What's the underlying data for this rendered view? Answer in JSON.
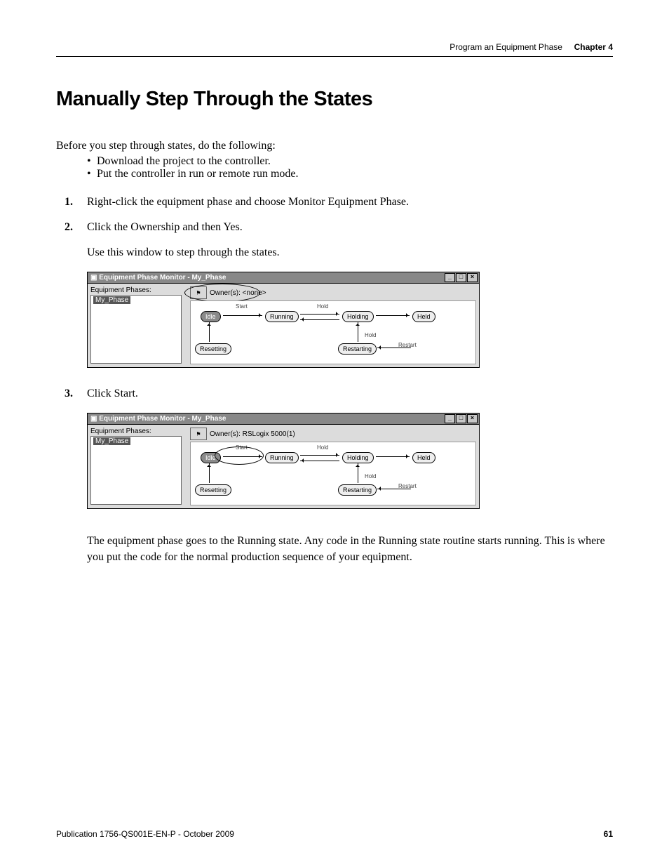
{
  "header": {
    "left": "Program an Equipment Phase",
    "right": "Chapter 4"
  },
  "title": "Manually Step Through the States",
  "intro": "Before you step through states, do the following:",
  "bullets": [
    "Download the project to the controller.",
    "Put the controller in run or remote run mode."
  ],
  "steps": {
    "s1_num": "1.",
    "s1": "Right-click the equipment phase and choose Monitor Equipment Phase.",
    "s2_num": "2.",
    "s2": "Click the Ownership and then Yes.",
    "s2_sub": "Use this window to step through the states.",
    "s3_num": "3.",
    "s3": "Click Start."
  },
  "win1": {
    "title": "Equipment Phase Monitor - My_Phase",
    "tree_label": "Equipment Phases:",
    "tree_item": "My_Phase",
    "owner_label": "Owner(s): <none>",
    "states": {
      "idle": "Idle",
      "running": "Running",
      "holding": "Holding",
      "held": "Held",
      "resetting": "Resetting",
      "restarting": "Restarting"
    },
    "labels": {
      "start": "Start",
      "hold1": "Hold",
      "hold2": "Hold",
      "restart": "Restart"
    }
  },
  "win2": {
    "title": "Equipment Phase Monitor - My_Phase",
    "tree_label": "Equipment Phases:",
    "tree_item": "My_Phase",
    "owner_label": "Owner(s): RSLogix 5000(1)",
    "states": {
      "idle": "Idle",
      "running": "Running",
      "holding": "Holding",
      "held": "Held",
      "resetting": "Resetting",
      "restarting": "Restarting"
    },
    "labels": {
      "start": "Start",
      "hold1": "Hold",
      "hold2": "Hold",
      "restart": "Restart"
    }
  },
  "para_after": "The equipment phase goes to the Running state. Any code in the Running state routine starts running. This is where you put the code for the normal production sequence of your equipment.",
  "footer": {
    "pub": "Publication 1756-QS001E-EN-P - October 2009",
    "page": "61"
  },
  "window_controls": {
    "min": "_",
    "max": "□",
    "close": "×"
  }
}
